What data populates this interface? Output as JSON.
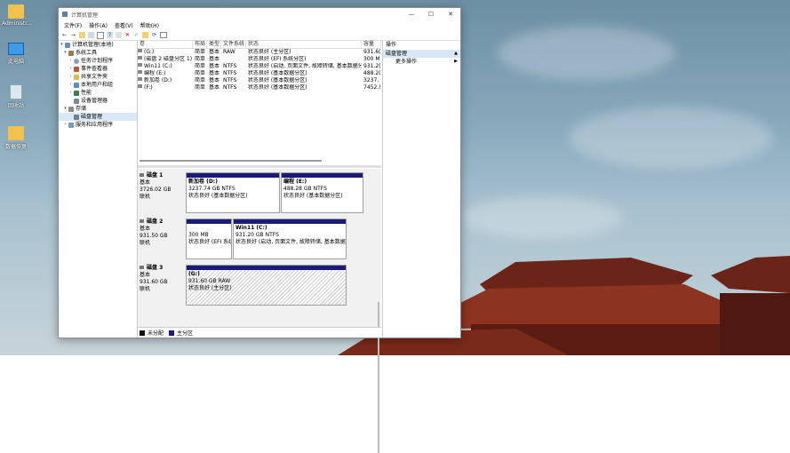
{
  "desktop": {
    "icons": [
      {
        "label": "Administr...",
        "type": "folder"
      },
      {
        "label": "此电脑",
        "type": "monitor"
      },
      {
        "label": "回收站",
        "type": "recycle"
      },
      {
        "label": "数据恢复",
        "type": "folder"
      }
    ]
  },
  "window": {
    "title": "计算机管理",
    "controls": {
      "min": "—",
      "max": "☐",
      "close": "✕"
    },
    "menu": [
      "文件(F)",
      "操作(A)",
      "查看(V)",
      "帮助(H)"
    ],
    "toolbar_icons": [
      "back-icon",
      "forward-icon",
      "up-icon",
      "folder-icon",
      "list-icon",
      "help-icon",
      "properties-icon",
      "delete-icon",
      "check-icon",
      "export-icon",
      "refresh-icon",
      "view-icon"
    ]
  },
  "tree": {
    "root": "计算机管理(本地)",
    "system_tools": "系统工具",
    "task_scheduler": "任务计划程序",
    "event_viewer": "事件查看器",
    "shared_folders": "共享文件夹",
    "local_users": "本地用户和组",
    "performance": "性能",
    "device_manager": "设备管理器",
    "storage": "存储",
    "disk_management": "磁盘管理",
    "services": "服务和应用程序"
  },
  "volumes": {
    "headers": [
      "卷",
      "布局",
      "类型",
      "文件系统",
      "状态",
      "容量"
    ],
    "rows": [
      {
        "vol": "(G:)",
        "layout": "简单",
        "type": "基本",
        "fs": "RAW",
        "status": "状态良好 (主分区)",
        "cap": "931.6("
      },
      {
        "vol": "(磁盘 2 磁盘分区 1)",
        "layout": "简单",
        "type": "基本",
        "fs": "",
        "status": "状态良好 (EFI 系统分区)",
        "cap": "300 M"
      },
      {
        "vol": "Win11 (C:)",
        "layout": "简单",
        "type": "基本",
        "fs": "NTFS",
        "status": "状态良好 (启动, 页面文件, 故障转储, 基本数据分区)",
        "cap": "931.2("
      },
      {
        "vol": "编程 (E:)",
        "layout": "简单",
        "type": "基本",
        "fs": "NTFS",
        "status": "状态良好 (基本数据分区)",
        "cap": "488.2("
      },
      {
        "vol": "新加卷 (D:)",
        "layout": "简单",
        "type": "基本",
        "fs": "NTFS",
        "status": "状态良好 (基本数据分区)",
        "cap": "3237."
      },
      {
        "vol": "(F:)",
        "layout": "简单",
        "type": "基本",
        "fs": "NTFS",
        "status": "状态良好 (基本数据分区)",
        "cap": "7452.!"
      }
    ]
  },
  "disks": [
    {
      "name": "磁盘 1",
      "kind": "基本",
      "size": "3726.02 GB",
      "state": "联机",
      "parts": [
        {
          "title": "新加卷 (D:)",
          "line2": "3237.74 GB NTFS",
          "line3": "状态良好 (基本数据分区)"
        },
        {
          "title": "编程 (E:)",
          "line2": "488.28 GB NTFS",
          "line3": "状态良好 (基本数据分区)"
        }
      ]
    },
    {
      "name": "磁盘 2",
      "kind": "基本",
      "size": "931.50 GB",
      "state": "联机",
      "parts": [
        {
          "title": "",
          "line2": "300 MB",
          "line3": "状态良好 (EFI 系统"
        },
        {
          "title": "Win11 (C:)",
          "line2": "931.20 GB NTFS",
          "line3": "状态良好 (启动, 页面文件, 故障转储, 基本数据"
        }
      ]
    },
    {
      "name": "磁盘 3",
      "kind": "基本",
      "size": "931.60 GB",
      "state": "联机",
      "parts": [
        {
          "title": "(G:)",
          "line2": "931.60 GB RAW",
          "line3": "状态良好 (主分区)"
        }
      ]
    }
  ],
  "legend": [
    "未分配",
    "主分区"
  ],
  "colors": {
    "primary_partition": "#1a1a7a",
    "unallocated": "#111111",
    "selection": "#d9e8f7"
  },
  "actions": {
    "header": "操作",
    "section": "磁盘管理",
    "more": "更多操作"
  }
}
